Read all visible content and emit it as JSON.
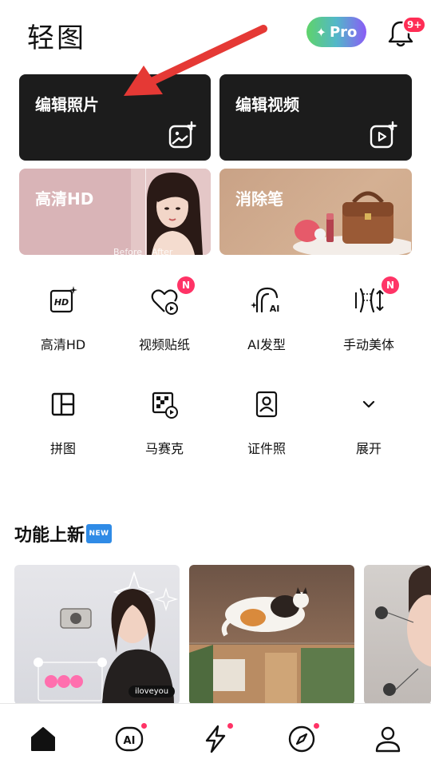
{
  "header": {
    "app_title": "轻图",
    "pro_label": "Pro",
    "pro_star": "✦",
    "notifications_badge": "9+"
  },
  "cards": {
    "edit_photo": "编辑照片",
    "edit_video": "编辑视频",
    "hd": "高清HD",
    "hd_before": "Before",
    "hd_after": "After",
    "eraser": "消除笔"
  },
  "tools": [
    {
      "label": "高清HD",
      "icon": "hd-icon",
      "badge": ""
    },
    {
      "label": "视频贴纸",
      "icon": "heart-video-icon",
      "badge": "N"
    },
    {
      "label": "AI发型",
      "icon": "ai-hair-icon",
      "badge": ""
    },
    {
      "label": "手动美体",
      "icon": "body-shape-icon",
      "badge": "N"
    },
    {
      "label": "拼图",
      "icon": "collage-icon",
      "badge": ""
    },
    {
      "label": "马赛克",
      "icon": "mosaic-icon",
      "badge": ""
    },
    {
      "label": "证件照",
      "icon": "id-photo-icon",
      "badge": ""
    },
    {
      "label": "展开",
      "icon": "chevron-down-icon",
      "badge": ""
    }
  ],
  "new_features": {
    "title": "功能上新",
    "new_chip": "NEW",
    "thumb1_caption": "iloveyou"
  },
  "bottom_nav": [
    {
      "icon": "home-icon",
      "active": true,
      "dot": false
    },
    {
      "icon": "ai-icon",
      "active": false,
      "dot": true
    },
    {
      "icon": "lightning-icon",
      "active": false,
      "dot": true
    },
    {
      "icon": "compass-icon",
      "active": false,
      "dot": true
    },
    {
      "icon": "profile-icon",
      "active": false,
      "dot": false
    }
  ],
  "colors": {
    "accent_red": "#ff3366",
    "card_dark": "#1c1c1c",
    "annotation_arrow": "#e53935"
  }
}
